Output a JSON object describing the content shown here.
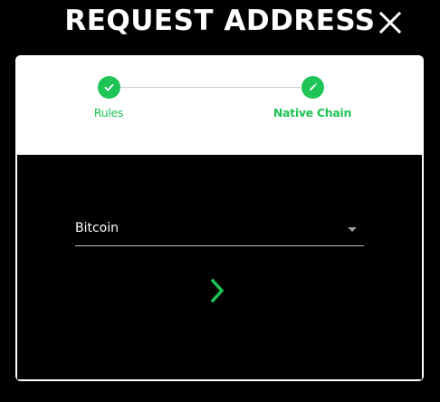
{
  "header": {
    "title": "REQUEST ADDRESS",
    "close_icon": "close-icon"
  },
  "stepper": {
    "steps": [
      {
        "label": "Rules",
        "icon": "check-icon",
        "state": "completed"
      },
      {
        "label": "Native Chain",
        "icon": "pencil-icon",
        "state": "active"
      }
    ]
  },
  "form": {
    "chain_select": {
      "value": "Bitcoin",
      "icon": "dropdown-arrow-icon"
    },
    "next_icon": "chevron-right-icon"
  },
  "colors": {
    "accent": "#1ec455",
    "background": "#000000",
    "card": "#ffffff"
  }
}
